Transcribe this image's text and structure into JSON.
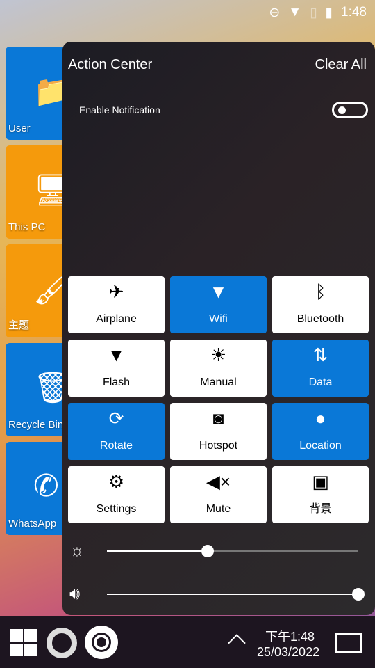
{
  "status_bar": {
    "time": "1:48",
    "icons": [
      "do-not-disturb-icon",
      "wifi-icon",
      "no-sim-icon",
      "battery-charging-icon"
    ]
  },
  "desktop": [
    {
      "label": "User",
      "color": "#0a78d7",
      "icon": "user-folder-icon"
    },
    {
      "label": "This PC",
      "color": "#f59a0c",
      "icon": "computer-icon"
    },
    {
      "label": "主题",
      "color": "#f59a0c",
      "icon": "theme-icon"
    },
    {
      "label": "Recycle Bin",
      "color": "#0a78d7",
      "icon": "recycle-bin-icon"
    },
    {
      "label": "WhatsApp",
      "color": "#0a78d7",
      "icon": "whatsapp-icon"
    }
  ],
  "action_center": {
    "title": "Action Center",
    "clear_all": "Clear All",
    "enable_notification": "Enable Notification",
    "notification_enabled": false,
    "tiles": [
      {
        "label": "Airplane",
        "icon": "airplane-icon",
        "active": false
      },
      {
        "label": "Wifi",
        "icon": "wifi-icon",
        "active": true
      },
      {
        "label": "Bluetooth",
        "icon": "bluetooth-icon",
        "active": false
      },
      {
        "label": "Flash",
        "icon": "flashlight-icon",
        "active": false
      },
      {
        "label": "Manual",
        "icon": "brightness-icon",
        "active": false
      },
      {
        "label": "Data",
        "icon": "data-arrows-icon",
        "active": true
      },
      {
        "label": "Rotate",
        "icon": "rotate-icon",
        "active": true
      },
      {
        "label": "Hotspot",
        "icon": "hotspot-icon",
        "active": false
      },
      {
        "label": "Location",
        "icon": "location-icon",
        "active": true
      },
      {
        "label": "Settings",
        "icon": "gear-icon",
        "active": false
      },
      {
        "label": "Mute",
        "icon": "mute-icon",
        "active": false
      },
      {
        "label": "背景",
        "icon": "image-icon",
        "active": false
      }
    ],
    "brightness": 0.4,
    "volume": 1.0
  },
  "taskbar": {
    "time": "下午1:48",
    "date": "25/03/2022"
  }
}
